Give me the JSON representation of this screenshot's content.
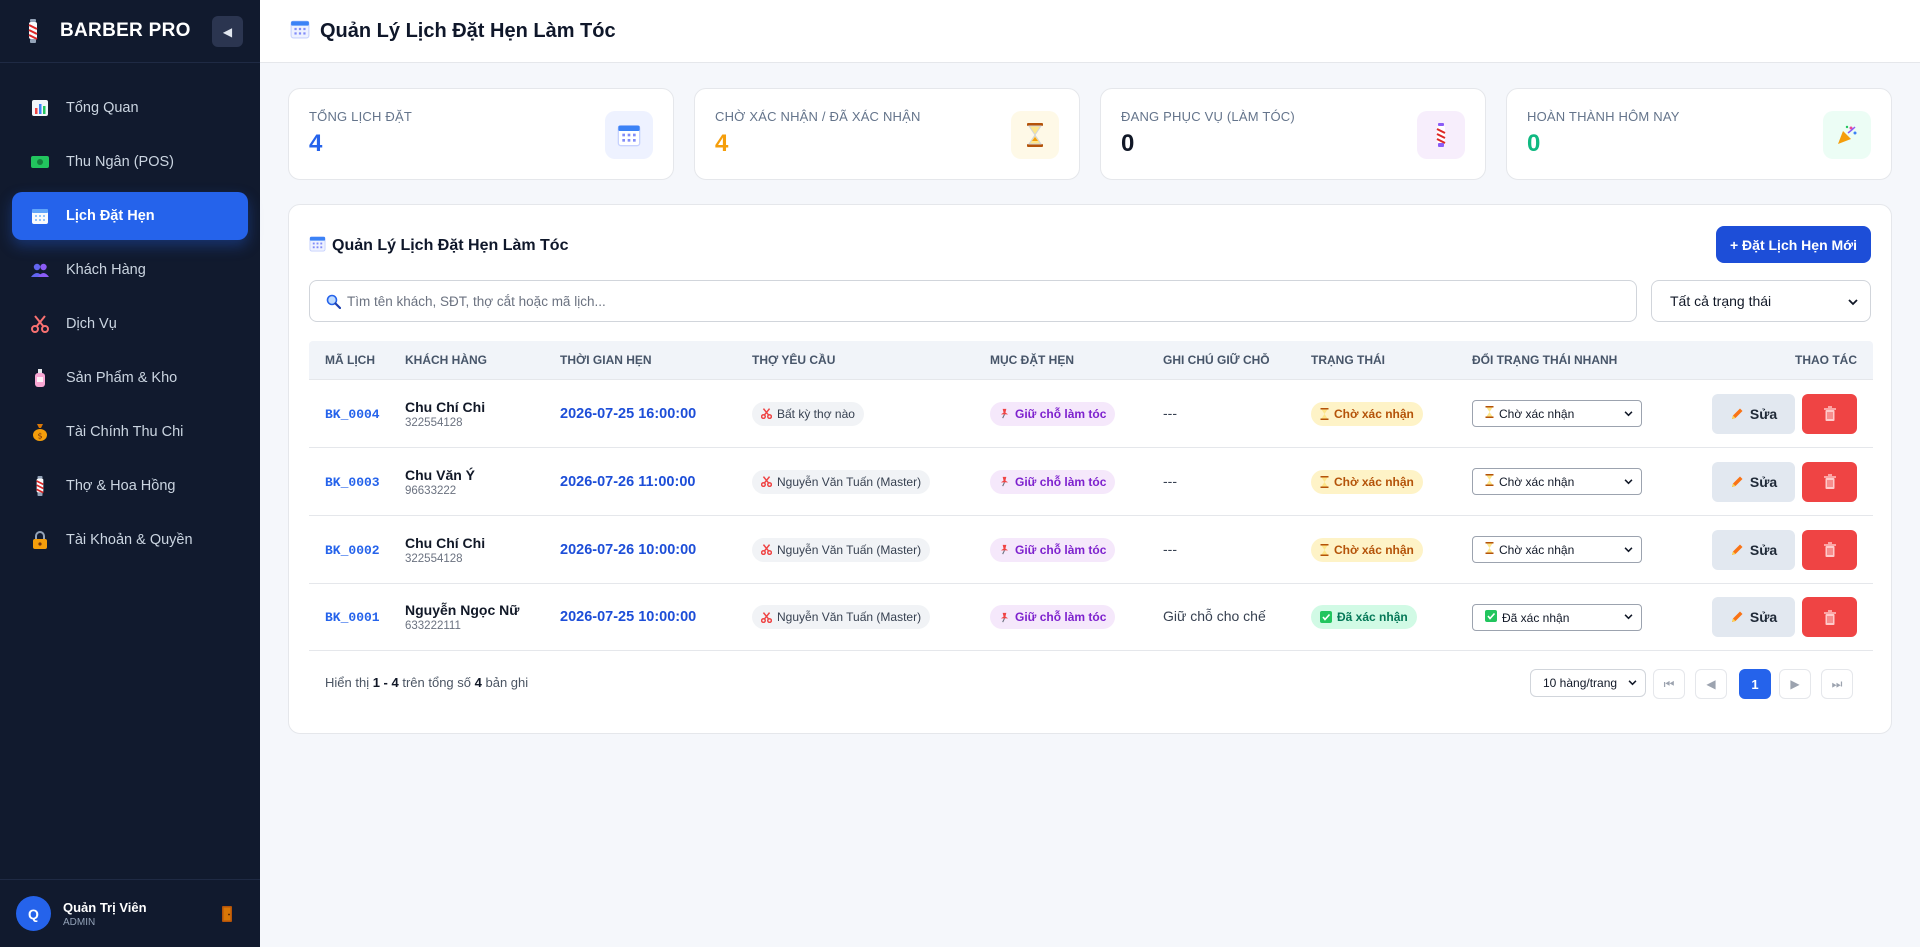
{
  "brand": {
    "title": "BARBER PRO",
    "collapse_label": "◀"
  },
  "sidebar": {
    "items": [
      {
        "label": "Tổng Quan",
        "icon": "chart-icon"
      },
      {
        "label": "Thu Ngân (POS)",
        "icon": "cash-icon"
      },
      {
        "label": "Lịch Đặt Hẹn",
        "icon": "calendar-icon",
        "active": true
      },
      {
        "label": "Khách Hàng",
        "icon": "users-icon"
      },
      {
        "label": "Dịch Vụ",
        "icon": "scissors-icon"
      },
      {
        "label": "Sản Phẩm & Kho",
        "icon": "bottle-icon"
      },
      {
        "label": "Tài Chính Thu Chi",
        "icon": "money-bag-icon"
      },
      {
        "label": "Thợ & Hoa Hồng",
        "icon": "barber-pole-icon"
      },
      {
        "label": "Tài Khoản & Quyền",
        "icon": "lock-icon"
      }
    ]
  },
  "user": {
    "initial": "Q",
    "name": "Quản Trị Viên",
    "role": "ADMIN"
  },
  "header": {
    "title": "Quản Lý Lịch Đặt Hẹn Làm Tóc"
  },
  "stats": [
    {
      "label": "TỔNG LỊCH ĐẶT",
      "value": "4",
      "color": "#2563eb",
      "icon": "calendar-icon",
      "icon_bg": "#eef2ff"
    },
    {
      "label": "CHỜ XÁC NHẬN / ĐÃ XÁC NHẬN",
      "value": "4",
      "color": "#f59e0b",
      "icon": "hourglass-icon",
      "icon_bg": "#fef9e7"
    },
    {
      "label": "ĐANG PHỤC VỤ (LÀM TÓC)",
      "value": "0",
      "color": "#111827",
      "icon": "barber-pole-icon",
      "icon_bg": "#f7eefc"
    },
    {
      "label": "HOÀN THÀNH HÔM NAY",
      "value": "0",
      "color": "#10b981",
      "icon": "party-icon",
      "icon_bg": "#ecfdf5"
    }
  ],
  "panel": {
    "title": "Quản Lý Lịch Đặt Hẹn Làm Tóc",
    "add_button": "+ Đặt Lịch Hẹn Mới",
    "search_placeholder": "Tìm tên khách, SĐT, thợ cắt hoặc mã lịch...",
    "status_filter": "Tất cả trạng thái"
  },
  "table": {
    "columns": [
      "MÃ LỊCH",
      "KHÁCH HÀNG",
      "THỜI GIAN HẸN",
      "THỢ YÊU CẦU",
      "MỤC ĐẶT HẸN",
      "GHI CHÚ GIỮ CHỖ",
      "TRẠNG THÁI",
      "ĐỔI TRẠNG THÁI NHANH",
      "THAO TÁC"
    ],
    "rows": [
      {
        "code": "BK_0004",
        "name": "Chu Chí Chi",
        "phone": "322554128",
        "time": "2026-07-25 16:00:00",
        "barber": "Bất kỳ thợ nào",
        "service": "Giữ chỗ làm tóc",
        "note": "---",
        "status": "Chờ xác nhận",
        "status_kind": "pending",
        "quick": "Chờ xác nhận",
        "edit": "Sửa"
      },
      {
        "code": "BK_0003",
        "name": "Chu Văn Ý",
        "phone": "96633222",
        "time": "2026-07-26 11:00:00",
        "barber": "Nguyễn Văn Tuấn (Master)",
        "service": "Giữ chỗ làm tóc",
        "note": "---",
        "status": "Chờ xác nhận",
        "status_kind": "pending",
        "quick": "Chờ xác nhận",
        "edit": "Sửa"
      },
      {
        "code": "BK_0002",
        "name": "Chu Chí Chi",
        "phone": "322554128",
        "time": "2026-07-26 10:00:00",
        "barber": "Nguyễn Văn Tuấn (Master)",
        "service": "Giữ chỗ làm tóc",
        "note": "---",
        "status": "Chờ xác nhận",
        "status_kind": "pending",
        "quick": "Chờ xác nhận",
        "edit": "Sửa"
      },
      {
        "code": "BK_0001",
        "name": "Nguyễn Ngọc Nữ",
        "phone": "633222111",
        "time": "2026-07-25 10:00:00",
        "barber": "Nguyễn Văn Tuấn (Master)",
        "service": "Giữ chỗ làm tóc",
        "note": "Giữ chỗ cho chế",
        "status": "Đã xác nhận",
        "status_kind": "confirmed",
        "quick": "Đã xác nhận",
        "edit": "Sửa"
      }
    ]
  },
  "pager": {
    "prefix": "Hiển thị",
    "range": "1 - 4",
    "middle": "trên tổng số",
    "total": "4",
    "suffix": "bản ghi",
    "page_size": "10 hàng/trang",
    "first": "⏮",
    "prev": "◀",
    "current": "1",
    "next": "▶",
    "last": "⏭"
  }
}
